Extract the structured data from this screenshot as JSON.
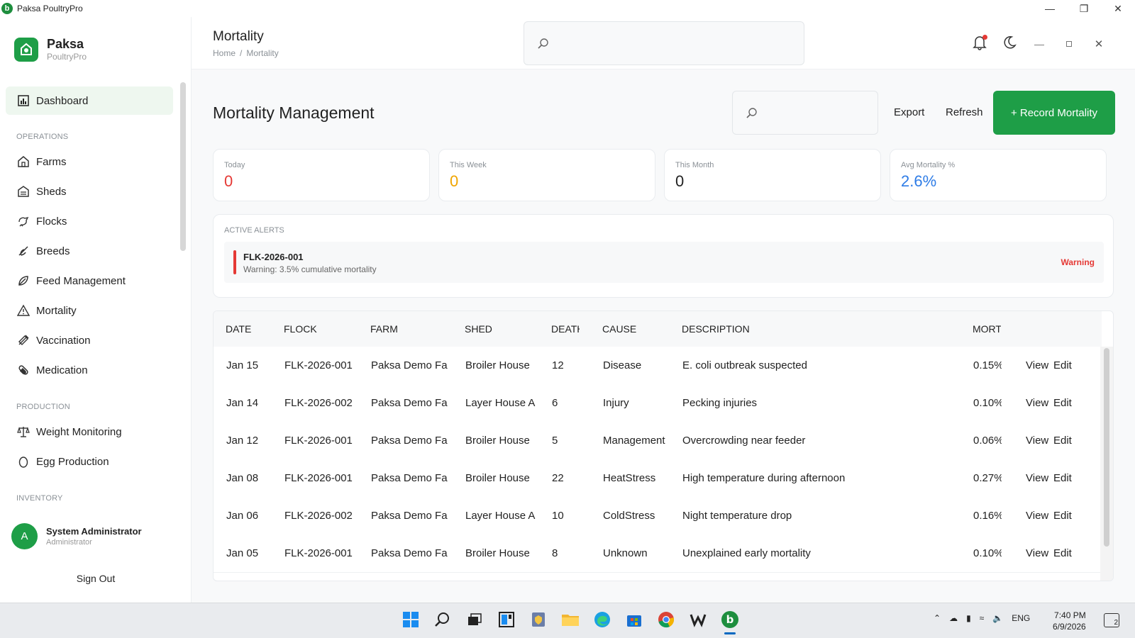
{
  "window": {
    "title": "Paksa PoultryPro",
    "logo_letter": "b"
  },
  "brand": {
    "name": "Paksa",
    "subtitle": "PoultryPro"
  },
  "sidebar": {
    "dashboard": "Dashboard",
    "sections": {
      "operations": "OPERATIONS",
      "production": "PRODUCTION",
      "inventory": "INVENTORY"
    },
    "items": [
      {
        "label": "Farms",
        "icon": "farm-icon"
      },
      {
        "label": "Sheds",
        "icon": "shed-icon"
      },
      {
        "label": "Flocks",
        "icon": "flock-icon"
      },
      {
        "label": "Breeds",
        "icon": "breed-icon"
      },
      {
        "label": "Feed Management",
        "icon": "feed-icon"
      },
      {
        "label": "Mortality",
        "icon": "warning-icon"
      },
      {
        "label": "Vaccination",
        "icon": "syringe-icon"
      },
      {
        "label": "Medication",
        "icon": "pill-icon"
      }
    ],
    "production_items": [
      {
        "label": "Weight Monitoring",
        "icon": "scale-icon"
      },
      {
        "label": "Egg Production",
        "icon": "egg-icon"
      }
    ],
    "user": {
      "initial": "A",
      "name": "System Administrator",
      "role": "Administrator"
    },
    "sign_out": "Sign Out"
  },
  "header": {
    "title": "Mortality",
    "breadcrumb": [
      "Home",
      "/",
      "Mortality"
    ]
  },
  "main": {
    "title": "Mortality Management",
    "export": "Export",
    "refresh": "Refresh",
    "record": "+ Record Mortality",
    "stats": [
      {
        "label": "Today",
        "value": "0",
        "color": "#e53935"
      },
      {
        "label": "This Week",
        "value": "0",
        "color": "#f0a500"
      },
      {
        "label": "This Month",
        "value": "0",
        "color": "#222222"
      },
      {
        "label": "Avg Mortality %",
        "value": "2.6%",
        "color": "#2e7ce6"
      }
    ],
    "alerts": {
      "title": "ACTIVE ALERTS",
      "items": [
        {
          "flock": "FLK-2026-001",
          "message": "Warning: 3.5% cumulative mortality",
          "level": "Warning"
        }
      ]
    },
    "table": {
      "headers": [
        "DATE",
        "FLOCK",
        "FARM",
        "SHED",
        "DEATH",
        "CAUSE",
        "DESCRIPTION",
        "MORT"
      ],
      "rows": [
        {
          "date": "Jan 15",
          "flock": "FLK-2026-001",
          "farm": "Paksa Demo Fa",
          "shed": "Broiler House",
          "deaths": "12",
          "cause": "Disease",
          "desc": "E. coli outbreak suspected",
          "mort": "0.15%",
          "view": "View",
          "edit": "Edit"
        },
        {
          "date": "Jan 14",
          "flock": "FLK-2026-002",
          "farm": "Paksa Demo Fa",
          "shed": "Layer House A",
          "deaths": "6",
          "cause": "Injury",
          "desc": "Pecking injuries",
          "mort": "0.10%",
          "view": "View",
          "edit": "Edit"
        },
        {
          "date": "Jan 12",
          "flock": "FLK-2026-001",
          "farm": "Paksa Demo Fa",
          "shed": "Broiler House",
          "deaths": "5",
          "cause": "Management",
          "desc": "Overcrowding near feeder",
          "mort": "0.06%",
          "view": "View",
          "edit": "Edit"
        },
        {
          "date": "Jan 08",
          "flock": "FLK-2026-001",
          "farm": "Paksa Demo Fa",
          "shed": "Broiler House",
          "deaths": "22",
          "cause": "HeatStress",
          "desc": "High temperature during afternoon",
          "mort": "0.27%",
          "view": "View",
          "edit": "Edit"
        },
        {
          "date": "Jan 06",
          "flock": "FLK-2026-002",
          "farm": "Paksa Demo Fa",
          "shed": "Layer House A",
          "deaths": "10",
          "cause": "ColdStress",
          "desc": "Night temperature drop",
          "mort": "0.16%",
          "view": "View",
          "edit": "Edit"
        },
        {
          "date": "Jan 05",
          "flock": "FLK-2026-001",
          "farm": "Paksa Demo Fa",
          "shed": "Broiler House",
          "deaths": "8",
          "cause": "Unknown",
          "desc": "Unexplained early mortality",
          "mort": "0.10%",
          "view": "View",
          "edit": "Edit"
        }
      ]
    }
  },
  "taskbar": {
    "tray_lang": "ENG",
    "time": "7:40 PM",
    "date": "6/9/2026",
    "notif_count": "2"
  },
  "colors": {
    "accent": "#1e9e47",
    "danger": "#e53935"
  }
}
